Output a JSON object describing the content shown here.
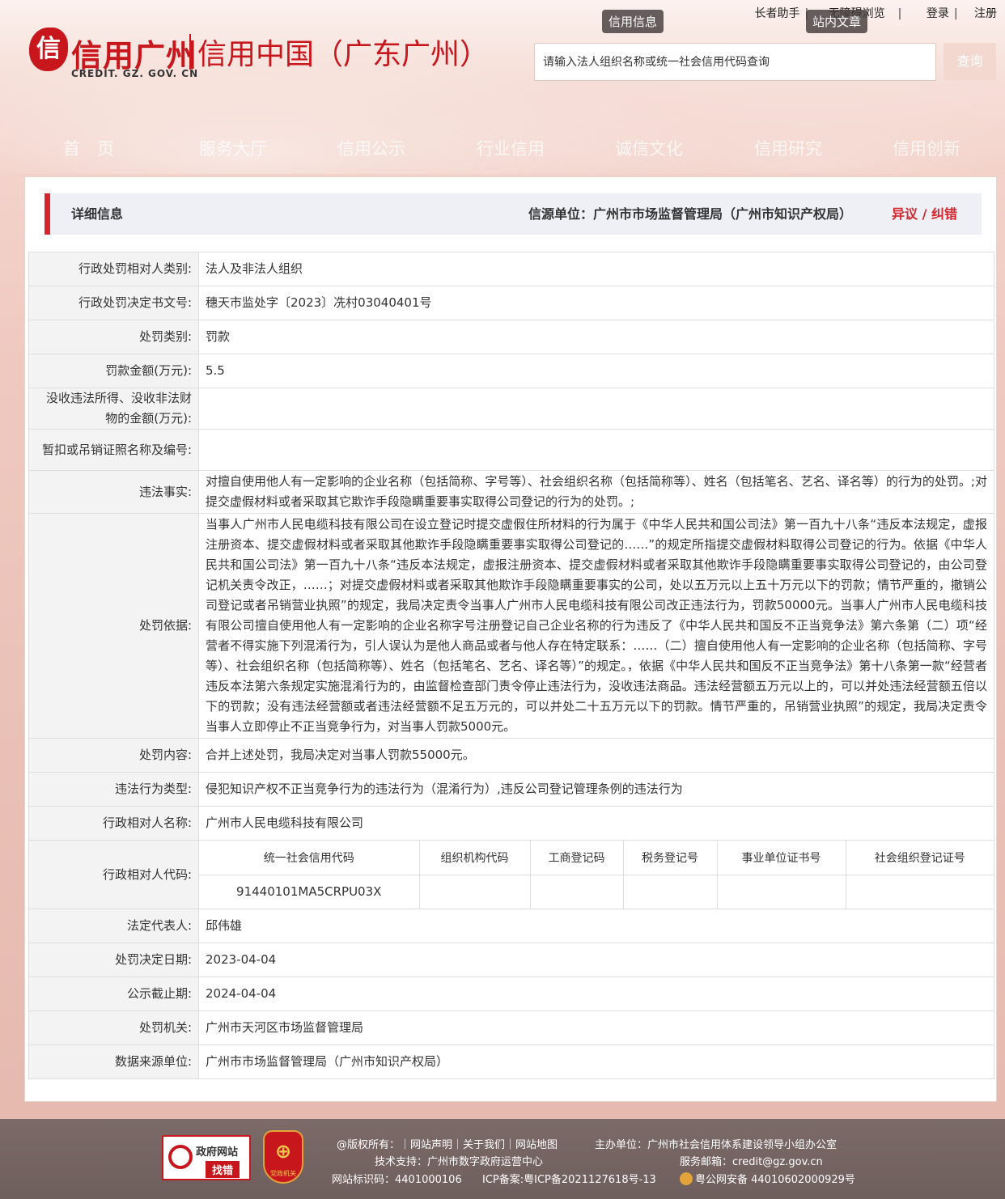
{
  "header": {
    "logo_mark": "信",
    "logo_main": "信用广州",
    "logo_sub": "信用中国（广东广州）",
    "logo_domain": "CREDIT. GZ. GOV. CN",
    "topbar": {
      "elder_helper": "长者助手",
      "accessible": "无障碍浏览",
      "login": "登录",
      "register": "注册"
    },
    "tooltip_credit_info": "信用信息",
    "tooltip_site_article": "站内文章",
    "search": {
      "placeholder": "请输入法人组织名称或统一社会信用代码查询",
      "button": "查询"
    },
    "nav": [
      "首　页",
      "服务大厅",
      "信用公示",
      "行业信用",
      "诚信文化",
      "信用研究",
      "信用创新"
    ]
  },
  "detail": {
    "title": "详细信息",
    "source_label": "信源单位：",
    "source_value": "广州市市场监督管理局（广州市知识产权局）",
    "objection": "异议 / 纠错"
  },
  "rows": {
    "subject_type": {
      "label": "行政处罚相对人类别:",
      "value": "法人及非法人组织"
    },
    "decision_no": {
      "label": "行政处罚决定书文号:",
      "value": "穗天市监处字〔2023〕冼村03040401号"
    },
    "penalty_type": {
      "label": "处罚类别:",
      "value": "罚款"
    },
    "fine_amount": {
      "label": "罚款金额(万元):",
      "value": "5.5"
    },
    "confiscation": {
      "label": "没收违法所得、没收非法财物的金额(万元):",
      "value": ""
    },
    "license_suspend": {
      "label": "暂扣或吊销证照名称及编号:",
      "value": ""
    },
    "violation_facts": {
      "label": "违法事实:",
      "value": "对擅自使用他人有一定影响的企业名称（包括简称、字号等）、社会组织名称（包括简称等）、姓名（包括笔名、艺名、译名等）的行为的处罚。;对提交虚假材料或者采取其它欺诈手段隐瞒重要事实取得公司登记的行为的处罚。;"
    },
    "penalty_basis": {
      "label": "处罚依据:",
      "value": "当事人广州市人民电缆科技有限公司在设立登记时提交虚假住所材料的行为属于《中华人民共和国公司法》第一百九十八条“违反本法规定，虚报注册资本、提交虚假材料或者采取其他欺诈手段隐瞒重要事实取得公司登记的……”的规定所指提交虚假材料取得公司登记的行为。依据《中华人民共和国公司法》第一百九十八条“违反本法规定，虚报注册资本、提交虚假材料或者采取其他欺诈手段隐瞒重要事实取得公司登记的，由公司登记机关责令改正，……；对提交虚假材料或者采取其他欺诈手段隐瞒重要事实的公司，处以五万元以上五十万元以下的罚款；情节严重的，撤销公司登记或者吊销营业执照”的规定，我局决定责令当事人广州市人民电缆科技有限公司改正违法行为，罚款50000元。当事人广州市人民电缆科技有限公司擅自使用他人有一定影响的企业名称字号注册登记自己企业名称的行为违反了《中华人民共和国反不正当竞争法》第六条第（二）项“经营者不得实施下列混淆行为，引人误认为是他人商品或者与他人存在特定联系：……（二）擅自使用他人有一定影响的企业名称（包括简称、字号等）、社会组织名称（包括简称等）、姓名（包括笔名、艺名、译名等）”的规定。，依据《中华人民共和国反不正当竞争法》第十八条第一款“经营者违反本法第六条规定实施混淆行为的，由监督检查部门责令停止违法行为，没收违法商品。违法经营额五万元以上的，可以并处违法经营额五倍以下的罚款；没有违法经营额或者违法经营额不足五万元的，可以并处二十五万元以下的罚款。情节严重的，吊销营业执照”的规定，我局决定责令当事人立即停止不正当竞争行为，对当事人罚款5000元。"
    },
    "penalty_content": {
      "label": "处罚内容:",
      "value": "合并上述处罚，我局决定对当事人罚款55000元。"
    },
    "violation_type": {
      "label": "违法行为类型:",
      "value": "侵犯知识产权不正当竞争行为的违法行为（混淆行为）,违反公司登记管理条例的违法行为"
    },
    "subject_name": {
      "label": "行政相对人名称:",
      "value": "广州市人民电缆科技有限公司"
    },
    "subject_code": {
      "label": "行政相对人代码:",
      "columns": [
        "统一社会信用代码",
        "组织机构代码",
        "工商登记码",
        "税务登记号",
        "事业单位证书号",
        "社会组织登记证号"
      ],
      "values": [
        "91440101MA5CRPU03X",
        "",
        "",
        "",
        "",
        ""
      ]
    },
    "legal_rep": {
      "label": "法定代表人:",
      "value": "邱伟雄"
    },
    "decision_date": {
      "label": "处罚决定日期:",
      "value": "2023-04-04"
    },
    "publicity_deadline": {
      "label": "公示截止期:",
      "value": "2024-04-04"
    },
    "authority": {
      "label": "处罚机关:",
      "value": "广州市天河区市场监督管理局"
    },
    "data_source": {
      "label": "数据来源单位:",
      "value": "广州市市场监督管理局（广州市知识产权局）"
    }
  },
  "footer": {
    "gov_badge_top": "政府网站",
    "gov_badge_bottom": "找错",
    "party_badge_label": "党政机关",
    "links": "@版权所有：｜网站声明｜关于我们｜网站地图",
    "organizer": "主办单位：广州市社会信用体系建设领导小组办公室",
    "tech_support": "技术支持：广州市数字政府运营中心",
    "email": "服务邮箱：credit@gz.gov.cn",
    "site_id": "网站标识码：4401000106",
    "icp": "ICP备案:粤ICP备2021127618号-13",
    "police": "粤公网安备 44010602000929号"
  }
}
